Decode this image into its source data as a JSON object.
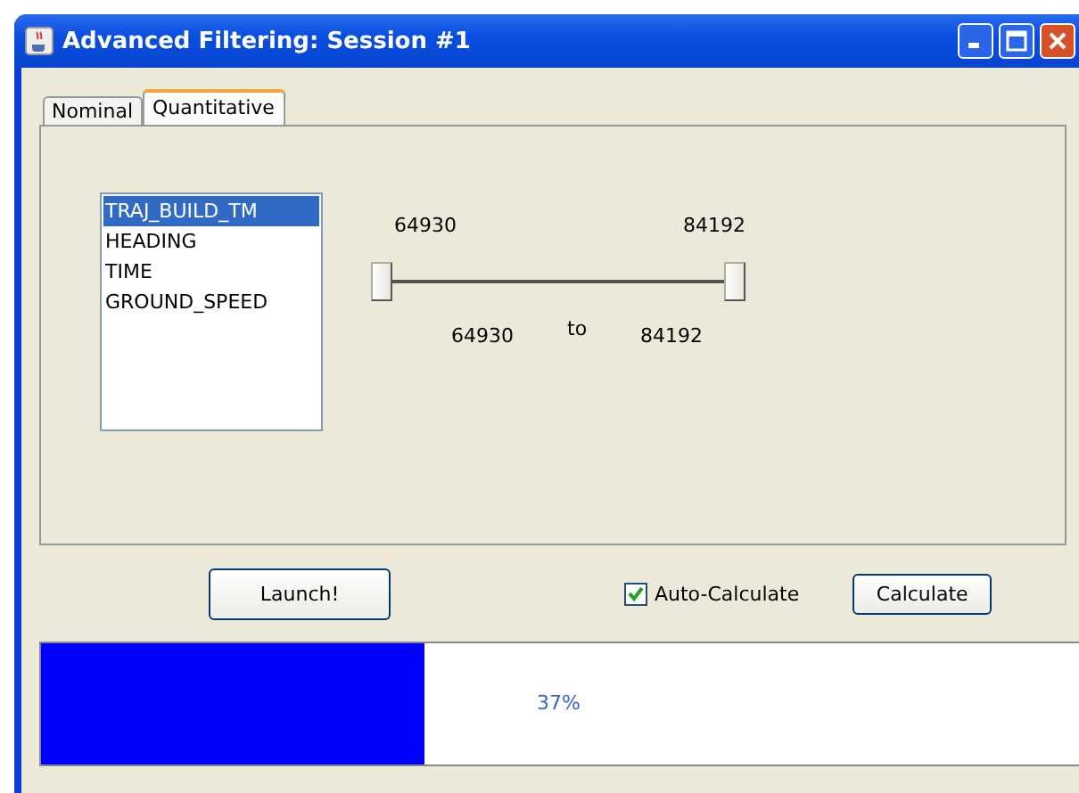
{
  "window": {
    "title": "Advanced Filtering: Session #1"
  },
  "tabs": [
    {
      "label": "Nominal",
      "selected": false
    },
    {
      "label": "Quantitative",
      "selected": true
    }
  ],
  "fields": [
    {
      "name": "TRAJ_BUILD_TM",
      "selected": true
    },
    {
      "name": "HEADING",
      "selected": false
    },
    {
      "name": "TIME",
      "selected": false
    },
    {
      "name": "GROUND_SPEED",
      "selected": false
    }
  ],
  "slider": {
    "min_label": "64930",
    "max_label": "84192",
    "thumbs": [
      {
        "level": 0
      },
      {
        "level": 1
      }
    ],
    "from": "64930",
    "to_word": "to",
    "to": "84192"
  },
  "launch_button": "Launch!",
  "auto_calculate": {
    "label": "Auto-Calculate",
    "checked": true
  },
  "calculate_button": "Calculate",
  "progress": {
    "level": 0.37,
    "label": "37%"
  }
}
